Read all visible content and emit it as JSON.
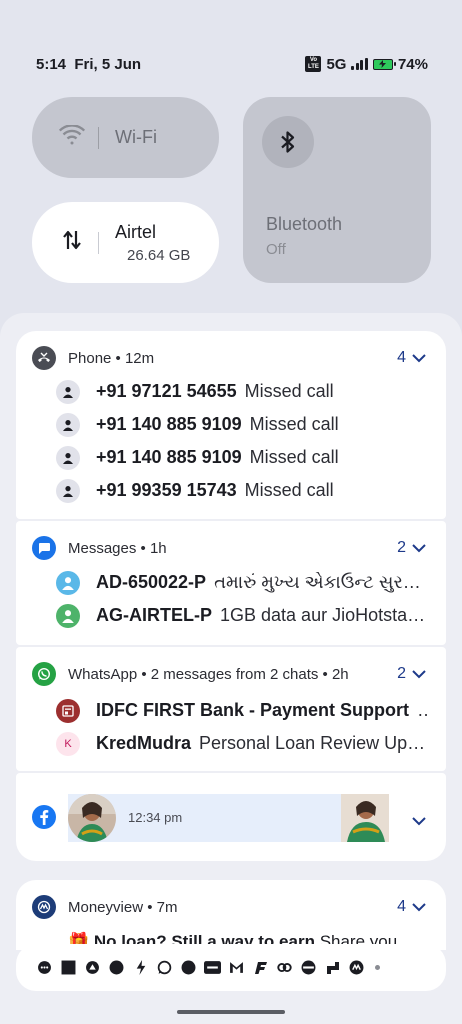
{
  "status_bar": {
    "time_date": "5:14  Fri, 5 Jun",
    "volte": "Vo LTE",
    "network": "5G",
    "battery": "74%"
  },
  "quick_settings": {
    "wifi": {
      "label": "Wi-Fi"
    },
    "mobile_data": {
      "label": "Airtel",
      "usage": "26.64 GB"
    },
    "bluetooth": {
      "label": "Bluetooth",
      "state": "Off"
    }
  },
  "notifications": {
    "phone": {
      "header": "Phone • 12m",
      "count": "4",
      "rows": [
        {
          "number": "+91 97121 54655",
          "text": "Missed call"
        },
        {
          "number": "+91 140 885 9109",
          "text": "Missed call"
        },
        {
          "number": "+91 140 885 9109",
          "text": "Missed call"
        },
        {
          "number": "+91 99359 15743",
          "text": "Missed call"
        }
      ]
    },
    "messages": {
      "header": "Messages • 1h",
      "count": "2",
      "rows": [
        {
          "sender": "AD-650022-P",
          "text": "તમારું મુખ્ય એકાઉન્ટ સુરક્ષિત…"
        },
        {
          "sender": "AG-AIRTEL-P",
          "text": "1GB data aur JioHotsta…"
        }
      ]
    },
    "whatsapp": {
      "header": "WhatsApp • 2 messages from 2 chats • 2h",
      "count": "2",
      "rows": [
        {
          "sender": "IDFC FIRST Bank - Payment Support",
          "text": "…",
          "avatar_letter": ""
        },
        {
          "sender": "KredMudra",
          "text": "Personal Loan Review Up…",
          "avatar_letter": "K"
        }
      ]
    },
    "facebook": {
      "time": "12:34 pm"
    },
    "moneyview": {
      "header": "Moneyview • 7m",
      "count": "4",
      "preview_emoji": "🎁",
      "preview_title": "No loan? Still a way to earn",
      "preview_text": "Share you"
    }
  },
  "colors": {
    "accent": "#1e3a8a",
    "whatsapp": "#25a244",
    "messages": "#1a73e8",
    "facebook": "#1877f2",
    "moneyview": "#1d3c78"
  },
  "icons": [
    "wifi-icon",
    "swap-vert-icon",
    "bluetooth-icon",
    "phone-missed-icon",
    "chat-bubble-icon",
    "whatsapp-icon",
    "facebook-icon",
    "moneyview-icon",
    "person-icon",
    "chevron-down-icon"
  ]
}
